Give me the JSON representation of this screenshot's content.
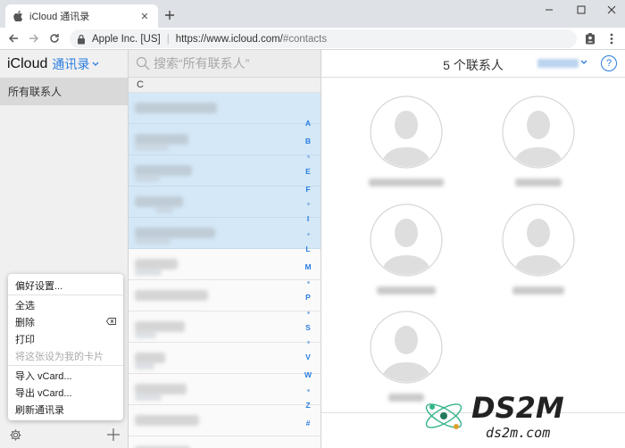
{
  "browser": {
    "tab_title": "iCloud 通讯录",
    "new_tab_icon": "plus-icon",
    "url_org": "Apple Inc. [US]",
    "url_host": "https://www.icloud.com/",
    "url_path": "#contacts"
  },
  "sidebar": {
    "brand": "iCloud",
    "app_name": "通讯录",
    "group": "所有联系人"
  },
  "menu": {
    "items": [
      {
        "label": "偏好设置...",
        "enabled": true
      },
      {
        "label": "全选",
        "enabled": true
      },
      {
        "label": "删除",
        "enabled": true,
        "icon": "delete-key-icon"
      },
      {
        "label": "打印",
        "enabled": true
      },
      {
        "label": "将这张设为我的卡片",
        "enabled": false
      },
      {
        "label": "导入 vCard...",
        "enabled": true
      },
      {
        "label": "导出 vCard...",
        "enabled": true
      },
      {
        "label": "刷新通讯录",
        "enabled": true
      }
    ]
  },
  "list": {
    "search_placeholder": "搜索“所有联系人”",
    "section_letter": "C",
    "index": [
      "A",
      "B",
      "•",
      "E",
      "F",
      "•",
      "I",
      "•",
      "L",
      "M",
      "•",
      "P",
      "•",
      "S",
      "•",
      "V",
      "W",
      "•",
      "Z",
      "#"
    ]
  },
  "main": {
    "count_label": "5 个联系人",
    "help_label": "?"
  },
  "watermark": {
    "logo_text": "DS2M",
    "site": "ds2m.com"
  },
  "colors": {
    "accent": "#2a7de1",
    "selected_row": "#d4e8f7",
    "sidebar_bg": "#f0f0f0"
  }
}
